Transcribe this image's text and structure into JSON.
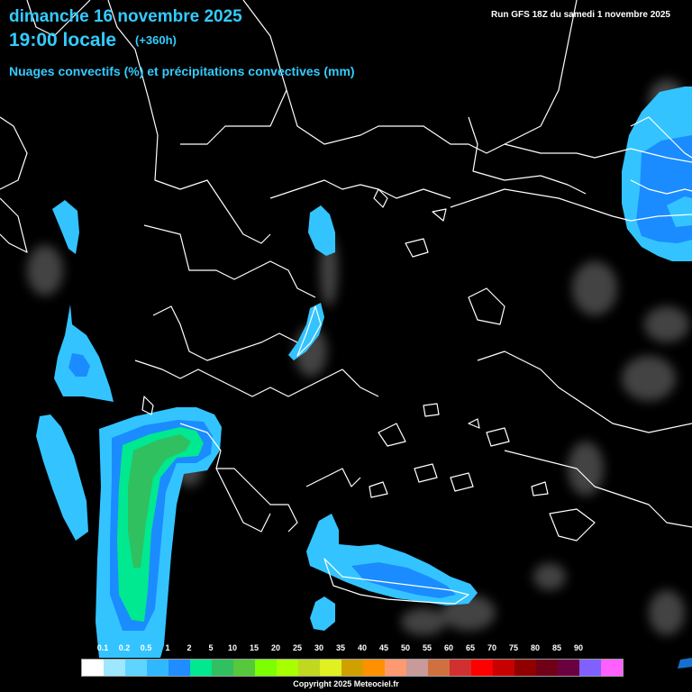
{
  "header": {
    "date": "dimanche 16 novembre 2025",
    "time": "19:00 locale",
    "offset": "(+360h)",
    "subtitle": "Nuages convectifs (%) et précipitations convectives (mm)",
    "run": "Run GFS 18Z du samedi 1 novembre 2025"
  },
  "legend": {
    "labels": [
      "0.1",
      "0.2",
      "0.5",
      "1",
      "2",
      "5",
      "10",
      "15",
      "20",
      "25",
      "30",
      "35",
      "40",
      "45",
      "50",
      "55",
      "60",
      "65",
      "70",
      "75",
      "80",
      "85",
      "90"
    ],
    "colors": [
      "#ffffff",
      "#9fe6ff",
      "#5fd4ff",
      "#30b8ff",
      "#1f8cff",
      "#00e890",
      "#30c060",
      "#56c83c",
      "#7cff00",
      "#a8ff00",
      "#c0d820",
      "#e0f020",
      "#d0a000",
      "#ff9000",
      "#ff9a70",
      "#c89a9a",
      "#d07040",
      "#d03030",
      "#ff0000",
      "#c80000",
      "#900000",
      "#700018",
      "#6a0040",
      "#8060ff",
      "#ff60ff"
    ]
  },
  "footer": {
    "copyright": "Copyright 2025 Meteociel.fr"
  },
  "colors": {
    "title": "#33ccff",
    "borders": "#ffffff",
    "background": "#000000"
  }
}
